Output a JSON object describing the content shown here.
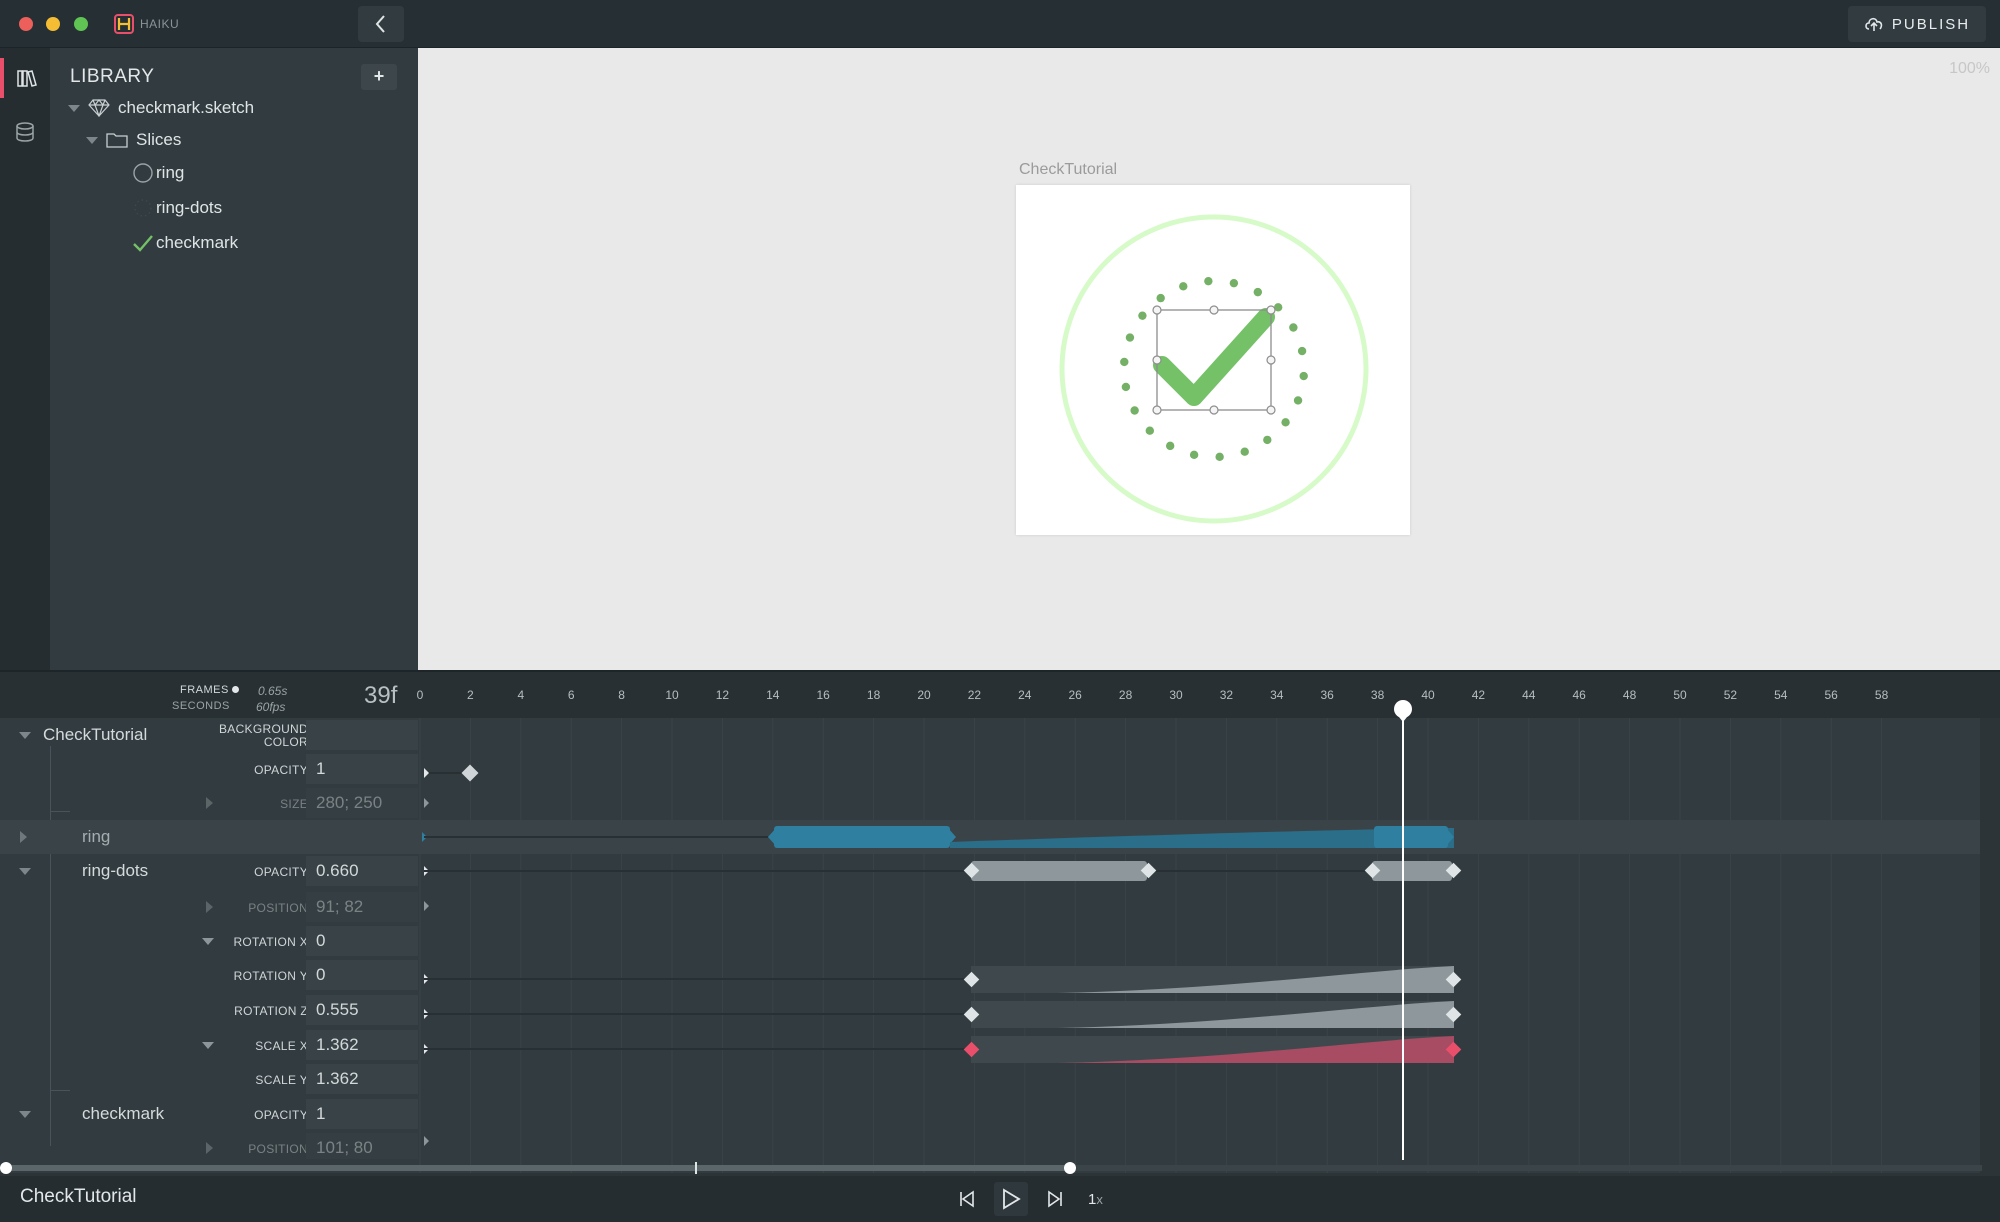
{
  "app": {
    "name": "HAIKU",
    "publish_label": "PUBLISH",
    "zoom": "100%"
  },
  "library": {
    "title": "LIBRARY",
    "add_label": "+",
    "items": [
      {
        "label": "checkmark.sketch",
        "icon": "sketch-diamond-icon"
      },
      {
        "label": "Slices",
        "icon": "folder-icon"
      },
      {
        "label": "ring",
        "icon": "ring-icon"
      },
      {
        "label": "ring-dots",
        "icon": "ring-dots-icon"
      },
      {
        "label": "checkmark",
        "icon": "checkmark-icon"
      }
    ]
  },
  "stage": {
    "artboard_label": "CheckTutorial"
  },
  "timeline": {
    "frames_label": "FRAMES",
    "seconds_label": "SECONDS",
    "time_seconds": "0.65s",
    "fps": "60fps",
    "current_frame": "39f",
    "ticks": [
      "0",
      "2",
      "4",
      "6",
      "8",
      "10",
      "12",
      "14",
      "16",
      "18",
      "20",
      "22",
      "24",
      "26",
      "28",
      "30",
      "32",
      "34",
      "36",
      "38",
      "40",
      "42",
      "44",
      "46",
      "48",
      "50",
      "52",
      "54",
      "56",
      "58"
    ],
    "playhead_frame": 39,
    "rows": {
      "checktutorial": {
        "name": "CheckTutorial",
        "background_color_label": "BACKGROUND COLOR",
        "opacity_label": "OPACITY",
        "opacity_value": "1",
        "size_label": "SIZE",
        "size_value": "280; 250"
      },
      "ring": {
        "name": "ring"
      },
      "ring_dots": {
        "name": "ring-dots",
        "opacity_label": "OPACITY",
        "opacity_value": "0.660",
        "position_label": "POSITION",
        "position_value": "91; 82",
        "rotation_x_label": "ROTATION X",
        "rotation_x_value": "0",
        "rotation_y_label": "ROTATION Y",
        "rotation_y_value": "0",
        "rotation_z_label": "ROTATION Z",
        "rotation_z_value": "0.555",
        "scale_x_label": "SCALE X",
        "scale_x_value": "1.362",
        "scale_y_label": "SCALE Y",
        "scale_y_value": "1.362"
      },
      "checkmark": {
        "name": "checkmark",
        "opacity_label": "OPACITY",
        "opacity_value": "1",
        "position_label": "POSITION",
        "position_value": "101; 80"
      }
    }
  },
  "bottombar": {
    "component_name": "CheckTutorial",
    "speed": "1",
    "speed_suffix": "x"
  },
  "colors": {
    "accent_pink": "#e94f6a",
    "ring_track": "#2e7fa0",
    "check_green": "#74c167",
    "ring_light": "#d6fbc8"
  }
}
